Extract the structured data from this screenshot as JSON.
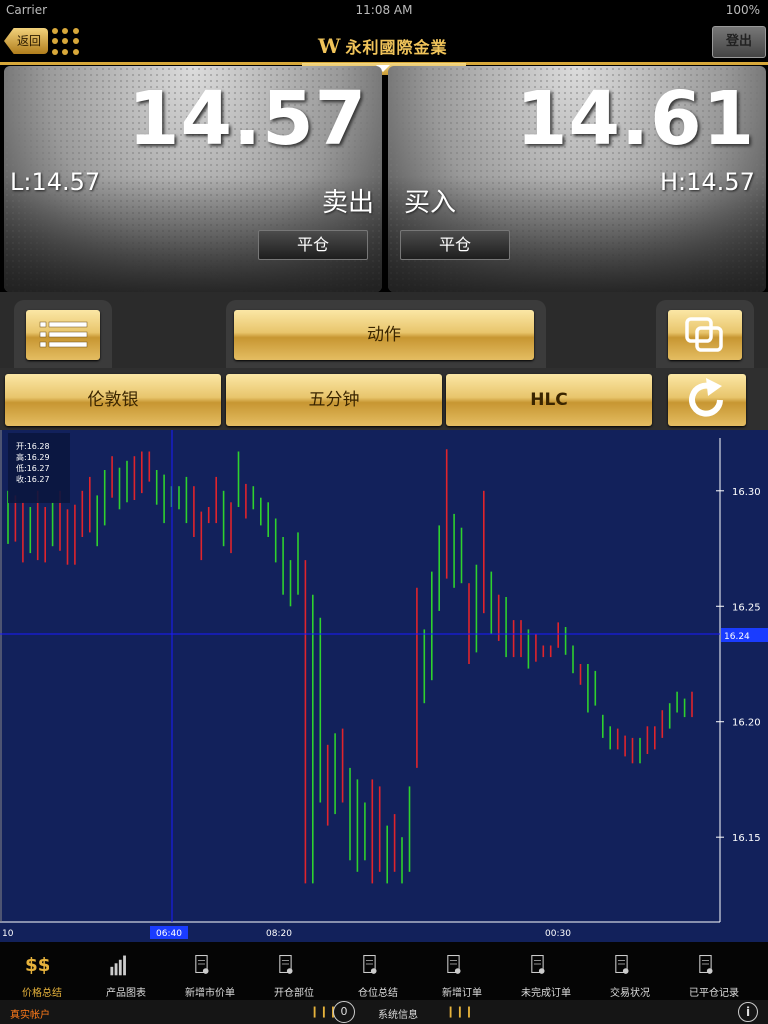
{
  "status_bar": {
    "carrier": "Carrier",
    "time": "11:08 AM",
    "battery": "100%"
  },
  "nav": {
    "back_label": "返回",
    "brand": "永利國際金業",
    "brand_mark": "W",
    "logout_label": "登出"
  },
  "sell_panel": {
    "price": "14.57",
    "low": "L:14.57",
    "side": "卖出",
    "close_label": "平仓"
  },
  "buy_panel": {
    "price": "14.61",
    "high": "H:14.57",
    "side": "买入",
    "close_label": "平仓"
  },
  "actions": {
    "action_label": "动作"
  },
  "selectors": {
    "product": "伦敦银",
    "interval": "五分钟",
    "chart_style": "HLC"
  },
  "colors": {
    "gold": "#e8c56c",
    "chart_bg": "#12215b",
    "up": "#2ed12e",
    "down": "#e0242c",
    "crosshair": "#1a1aff"
  },
  "chart_data": {
    "type": "hlc",
    "ohlc_box": {
      "open": "开:16.28",
      "high": "高:16.29",
      "low": "低:16.27",
      "close": "收:16.27"
    },
    "y_ticks": [
      "16.30",
      "16.25",
      "16.20",
      "16.15"
    ],
    "x_ticks": [
      "10",
      "08:20",
      "00:30"
    ],
    "crosshair_x_label": "06:40",
    "crosshair_y_label": "16.24",
    "ylim": [
      16.115,
      16.322
    ],
    "bars": [
      {
        "h": 16.3,
        "l": 16.277,
        "c": "g"
      },
      {
        "h": 16.298,
        "l": 16.278,
        "c": "r"
      },
      {
        "h": 16.295,
        "l": 16.269,
        "c": "r"
      },
      {
        "h": 16.293,
        "l": 16.273,
        "c": "g"
      },
      {
        "h": 16.3,
        "l": 16.27,
        "c": "r"
      },
      {
        "h": 16.293,
        "l": 16.269,
        "c": "r"
      },
      {
        "h": 16.295,
        "l": 16.276,
        "c": "g"
      },
      {
        "h": 16.3,
        "l": 16.274,
        "c": "r"
      },
      {
        "h": 16.292,
        "l": 16.268,
        "c": "r"
      },
      {
        "h": 16.294,
        "l": 16.268,
        "c": "r"
      },
      {
        "h": 16.3,
        "l": 16.28,
        "c": "r"
      },
      {
        "h": 16.306,
        "l": 16.282,
        "c": "r"
      },
      {
        "h": 16.298,
        "l": 16.276,
        "c": "g"
      },
      {
        "h": 16.309,
        "l": 16.285,
        "c": "g"
      },
      {
        "h": 16.315,
        "l": 16.297,
        "c": "r"
      },
      {
        "h": 16.31,
        "l": 16.292,
        "c": "g"
      },
      {
        "h": 16.313,
        "l": 16.295,
        "c": "g"
      },
      {
        "h": 16.315,
        "l": 16.296,
        "c": "r"
      },
      {
        "h": 16.317,
        "l": 16.299,
        "c": "r"
      },
      {
        "h": 16.317,
        "l": 16.304,
        "c": "r"
      },
      {
        "h": 16.309,
        "l": 16.294,
        "c": "g"
      },
      {
        "h": 16.307,
        "l": 16.286,
        "c": "g"
      },
      {
        "h": 16.302,
        "l": 16.293,
        "c": "g"
      },
      {
        "h": 16.302,
        "l": 16.292,
        "c": "g"
      },
      {
        "h": 16.306,
        "l": 16.286,
        "c": "g"
      },
      {
        "h": 16.302,
        "l": 16.28,
        "c": "r"
      },
      {
        "h": 16.291,
        "l": 16.27,
        "c": "r"
      },
      {
        "h": 16.293,
        "l": 16.286,
        "c": "r"
      },
      {
        "h": 16.306,
        "l": 16.286,
        "c": "r"
      },
      {
        "h": 16.3,
        "l": 16.276,
        "c": "g"
      },
      {
        "h": 16.295,
        "l": 16.273,
        "c": "r"
      },
      {
        "h": 16.317,
        "l": 16.293,
        "c": "g"
      },
      {
        "h": 16.303,
        "l": 16.288,
        "c": "r"
      },
      {
        "h": 16.302,
        "l": 16.292,
        "c": "g"
      },
      {
        "h": 16.297,
        "l": 16.285,
        "c": "g"
      },
      {
        "h": 16.295,
        "l": 16.28,
        "c": "g"
      },
      {
        "h": 16.288,
        "l": 16.269,
        "c": "g"
      },
      {
        "h": 16.28,
        "l": 16.255,
        "c": "g"
      },
      {
        "h": 16.27,
        "l": 16.25,
        "c": "g"
      },
      {
        "h": 16.282,
        "l": 16.255,
        "c": "g"
      },
      {
        "h": 16.27,
        "l": 16.13,
        "c": "r"
      },
      {
        "h": 16.255,
        "l": 16.13,
        "c": "g"
      },
      {
        "h": 16.245,
        "l": 16.165,
        "c": "g"
      },
      {
        "h": 16.19,
        "l": 16.155,
        "c": "r"
      },
      {
        "h": 16.195,
        "l": 16.16,
        "c": "g"
      },
      {
        "h": 16.197,
        "l": 16.165,
        "c": "r"
      },
      {
        "h": 16.18,
        "l": 16.14,
        "c": "g"
      },
      {
        "h": 16.175,
        "l": 16.135,
        "c": "g"
      },
      {
        "h": 16.165,
        "l": 16.14,
        "c": "g"
      },
      {
        "h": 16.175,
        "l": 16.13,
        "c": "r"
      },
      {
        "h": 16.172,
        "l": 16.135,
        "c": "r"
      },
      {
        "h": 16.155,
        "l": 16.13,
        "c": "g"
      },
      {
        "h": 16.16,
        "l": 16.135,
        "c": "r"
      },
      {
        "h": 16.15,
        "l": 16.13,
        "c": "g"
      },
      {
        "h": 16.172,
        "l": 16.135,
        "c": "g"
      },
      {
        "h": 16.258,
        "l": 16.18,
        "c": "r"
      },
      {
        "h": 16.24,
        "l": 16.208,
        "c": "g"
      },
      {
        "h": 16.265,
        "l": 16.218,
        "c": "g"
      },
      {
        "h": 16.285,
        "l": 16.248,
        "c": "g"
      },
      {
        "h": 16.318,
        "l": 16.262,
        "c": "r"
      },
      {
        "h": 16.29,
        "l": 16.258,
        "c": "g"
      },
      {
        "h": 16.284,
        "l": 16.26,
        "c": "g"
      },
      {
        "h": 16.26,
        "l": 16.225,
        "c": "r"
      },
      {
        "h": 16.268,
        "l": 16.23,
        "c": "g"
      },
      {
        "h": 16.3,
        "l": 16.247,
        "c": "r"
      },
      {
        "h": 16.265,
        "l": 16.238,
        "c": "g"
      },
      {
        "h": 16.255,
        "l": 16.235,
        "c": "r"
      },
      {
        "h": 16.254,
        "l": 16.228,
        "c": "g"
      },
      {
        "h": 16.244,
        "l": 16.228,
        "c": "r"
      },
      {
        "h": 16.244,
        "l": 16.228,
        "c": "r"
      },
      {
        "h": 16.24,
        "l": 16.223,
        "c": "g"
      },
      {
        "h": 16.238,
        "l": 16.226,
        "c": "r"
      },
      {
        "h": 16.233,
        "l": 16.228,
        "c": "r"
      },
      {
        "h": 16.233,
        "l": 16.228,
        "c": "r"
      },
      {
        "h": 16.243,
        "l": 16.232,
        "c": "r"
      },
      {
        "h": 16.241,
        "l": 16.229,
        "c": "g"
      },
      {
        "h": 16.233,
        "l": 16.221,
        "c": "g"
      },
      {
        "h": 16.225,
        "l": 16.216,
        "c": "r"
      },
      {
        "h": 16.225,
        "l": 16.204,
        "c": "g"
      },
      {
        "h": 16.222,
        "l": 16.207,
        "c": "g"
      },
      {
        "h": 16.203,
        "l": 16.193,
        "c": "g"
      },
      {
        "h": 16.198,
        "l": 16.188,
        "c": "g"
      },
      {
        "h": 16.197,
        "l": 16.188,
        "c": "r"
      },
      {
        "h": 16.194,
        "l": 16.185,
        "c": "r"
      },
      {
        "h": 16.193,
        "l": 16.182,
        "c": "r"
      },
      {
        "h": 16.193,
        "l": 16.182,
        "c": "g"
      },
      {
        "h": 16.198,
        "l": 16.186,
        "c": "r"
      },
      {
        "h": 16.198,
        "l": 16.188,
        "c": "r"
      },
      {
        "h": 16.205,
        "l": 16.193,
        "c": "r"
      },
      {
        "h": 16.208,
        "l": 16.197,
        "c": "g"
      },
      {
        "h": 16.213,
        "l": 16.204,
        "c": "g"
      },
      {
        "h": 16.21,
        "l": 16.202,
        "c": "g"
      },
      {
        "h": 16.213,
        "l": 16.202,
        "c": "r"
      }
    ]
  },
  "tabs": [
    {
      "label": "价格总结",
      "icon": "price-summary-icon",
      "active": true
    },
    {
      "label": "产品图表",
      "icon": "bar-chart-icon",
      "active": false
    },
    {
      "label": "新增市价单",
      "icon": "new-market-order-icon",
      "active": false
    },
    {
      "label": "开仓部位",
      "icon": "open-position-icon",
      "active": false
    },
    {
      "label": "仓位总结",
      "icon": "position-summary-icon",
      "active": false
    },
    {
      "label": "新增订单",
      "icon": "new-order-icon",
      "active": false
    },
    {
      "label": "未完成订单",
      "icon": "pending-order-icon",
      "active": false
    },
    {
      "label": "交易状况",
      "icon": "trade-status-icon",
      "active": false
    },
    {
      "label": "已平仓记录",
      "icon": "closed-record-icon",
      "active": false
    }
  ],
  "footer": {
    "account": "真实帐户",
    "badge": "0",
    "system_info": "系统信息"
  }
}
